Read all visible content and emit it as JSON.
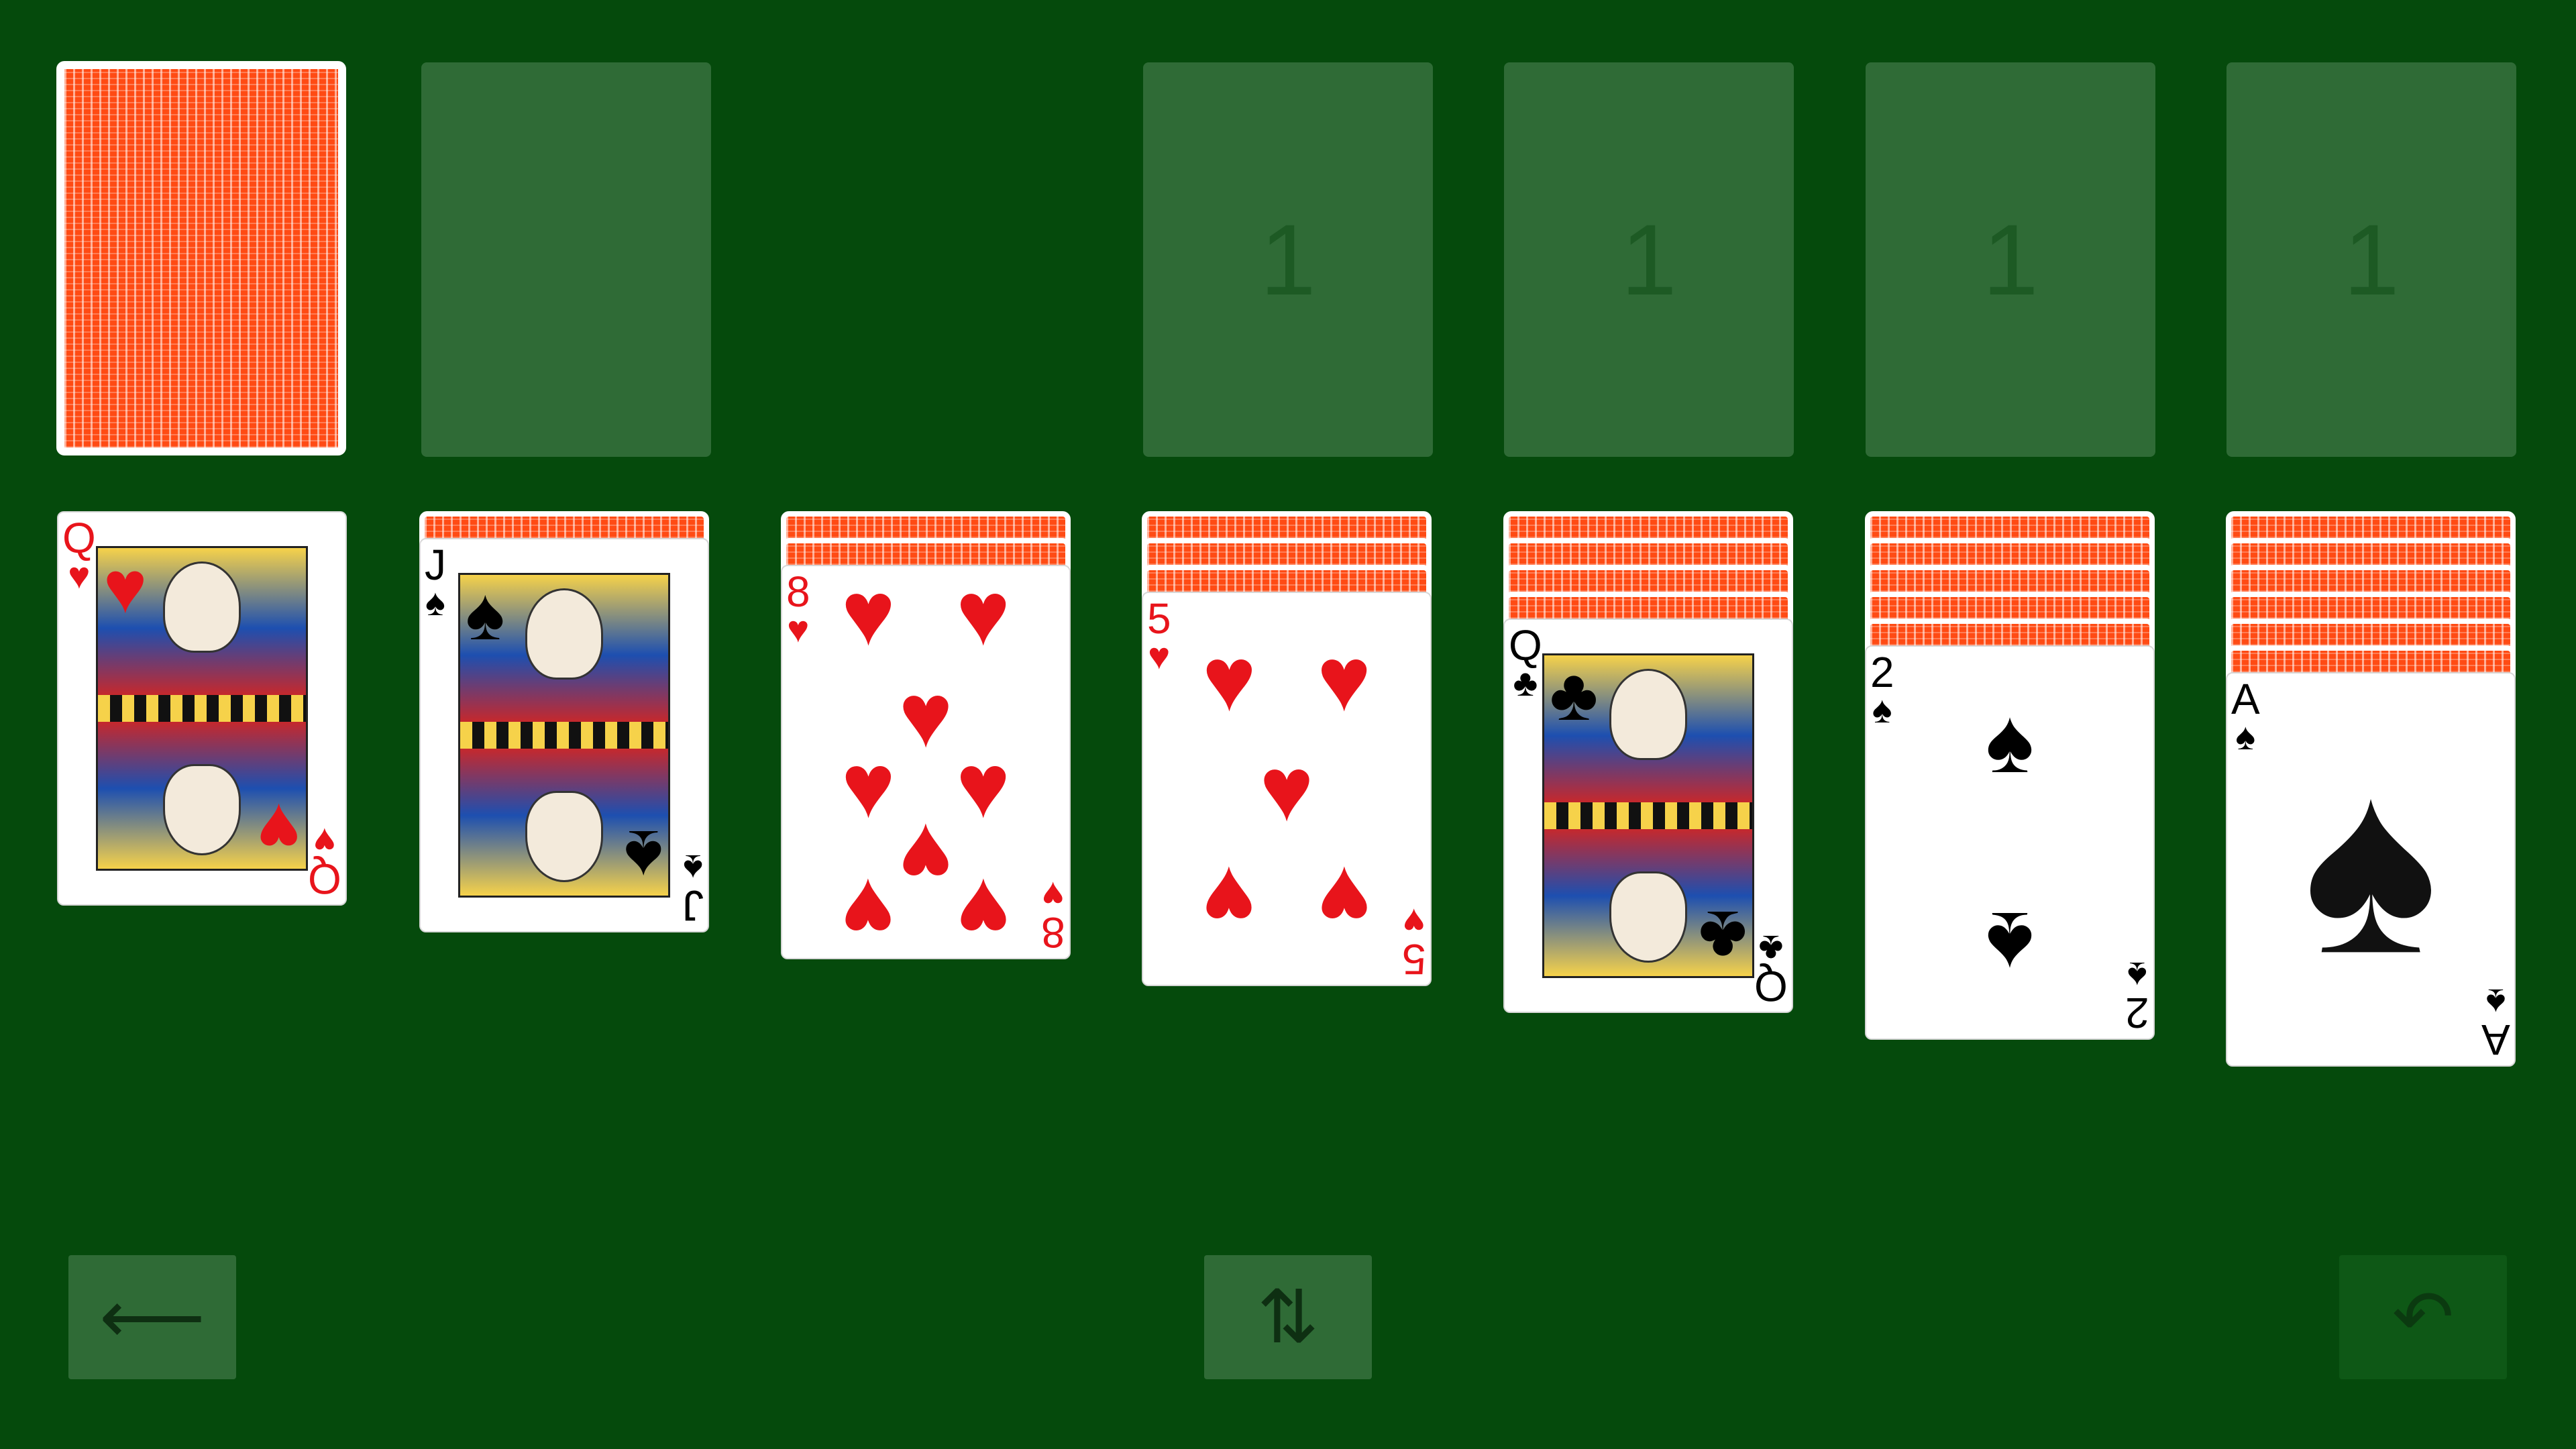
{
  "stock": {
    "face_down": true
  },
  "foundations": [
    {
      "label": "1"
    },
    {
      "label": "1"
    },
    {
      "label": "1"
    },
    {
      "label": "1"
    }
  ],
  "tableau": [
    {
      "hidden": 0,
      "card": {
        "rank": "Q",
        "suit": "♥",
        "color": "red",
        "kind": "face"
      }
    },
    {
      "hidden": 1,
      "card": {
        "rank": "J",
        "suit": "♠",
        "color": "black",
        "kind": "face"
      }
    },
    {
      "hidden": 2,
      "card": {
        "rank": "8",
        "suit": "♥",
        "color": "red",
        "kind": "pips"
      }
    },
    {
      "hidden": 3,
      "card": {
        "rank": "5",
        "suit": "♥",
        "color": "red",
        "kind": "pips"
      }
    },
    {
      "hidden": 4,
      "card": {
        "rank": "Q",
        "suit": "♣",
        "color": "black",
        "kind": "face"
      }
    },
    {
      "hidden": 5,
      "card": {
        "rank": "2",
        "suit": "♠",
        "color": "black",
        "kind": "pips"
      }
    },
    {
      "hidden": 6,
      "card": {
        "rank": "A",
        "suit": "♠",
        "color": "black",
        "kind": "ace"
      }
    }
  ],
  "controls": {
    "back": {
      "icon": "left-arrow-icon",
      "glyph": "⟵"
    },
    "swap": {
      "icon": "swap-vertical-icon",
      "glyph": "⇅"
    },
    "undo": {
      "icon": "undo-icon",
      "glyph": "↶"
    }
  },
  "colors": {
    "table": "#054a0c",
    "slot": "#2f6b36",
    "card_back": "#ff4b14",
    "red_suit": "#e8141b"
  }
}
